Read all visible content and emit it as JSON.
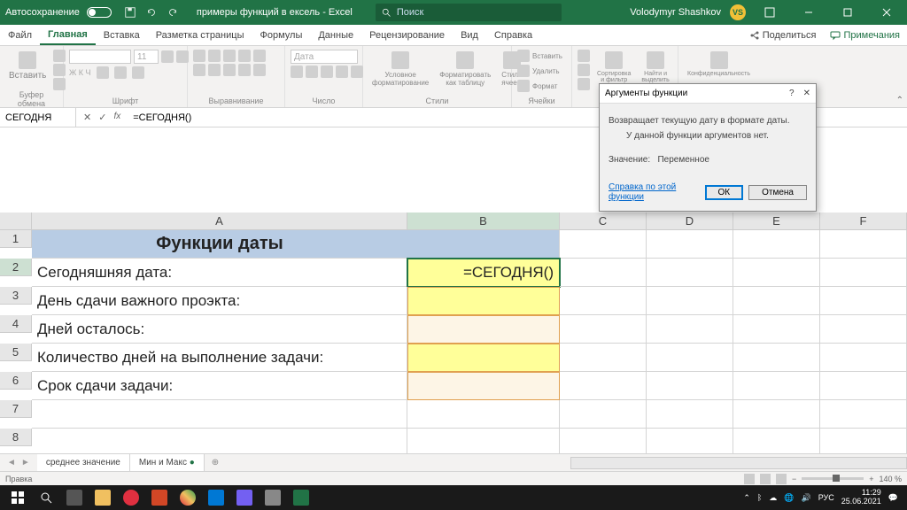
{
  "titlebar": {
    "autosave": "Автосохранение",
    "doc": "примеры функций в ексель - Excel",
    "search": "Поиск",
    "user": "Volodymyr Shashkov",
    "initials": "VS"
  },
  "tabs": {
    "file": "Файл",
    "home": "Главная",
    "insert": "Вставка",
    "layout": "Разметка страницы",
    "formulas": "Формулы",
    "data": "Данные",
    "review": "Рецензирование",
    "view": "Вид",
    "help": "Справка",
    "share": "Поделиться",
    "comments": "Примечания"
  },
  "ribbon": {
    "clipboard": "Буфер обмена",
    "paste": "Вставить",
    "font": "Шрифт",
    "align": "Выравнивание",
    "number": "Число",
    "date": "Дата",
    "styles": "Стили",
    "cond": "Условное форматирование",
    "table": "Форматировать как таблицу",
    "cellstyles": "Стили ячеек",
    "cells": "Ячейки",
    "ins": "Вставить",
    "del": "Удалить",
    "fmt": "Формат",
    "editing": "",
    "sort": "Сортировка и фильтр",
    "find": "Найти и выделить",
    "conf": "Конфиденциальность"
  },
  "fbar": {
    "name": "СЕГОДНЯ",
    "formula": "=СЕГОДНЯ()"
  },
  "columns": [
    "A",
    "B",
    "C",
    "D",
    "E",
    "F"
  ],
  "rows": [
    "1",
    "2",
    "3",
    "4",
    "5",
    "6",
    "7",
    "8"
  ],
  "cells": {
    "A1": "Функции даты",
    "A2": "Сегодняшняя дата:",
    "A3": "День сдачи важного проэкта:",
    "A4": "Дней осталось:",
    "A5": "Количество дней на выполнение задачи:",
    "A6": "Срок сдачи задачи:",
    "B2": "=СЕГОДНЯ()"
  },
  "sheets": {
    "s1": "среднее значение",
    "s2": "Мин и Макс"
  },
  "status": {
    "mode": "Правка",
    "zoom": "140 %"
  },
  "dialog": {
    "title": "Аргументы функции",
    "desc1": "Возвращает текущую дату в формате даты.",
    "desc2": "У данной функции аргументов нет.",
    "valuelbl": "Значение:",
    "value": "Переменное",
    "help": "Справка по этой функции",
    "ok": "ОК",
    "cancel": "Отмена"
  },
  "tray": {
    "lang": "РУС",
    "time": "11:29",
    "date": "25.06.2021"
  }
}
